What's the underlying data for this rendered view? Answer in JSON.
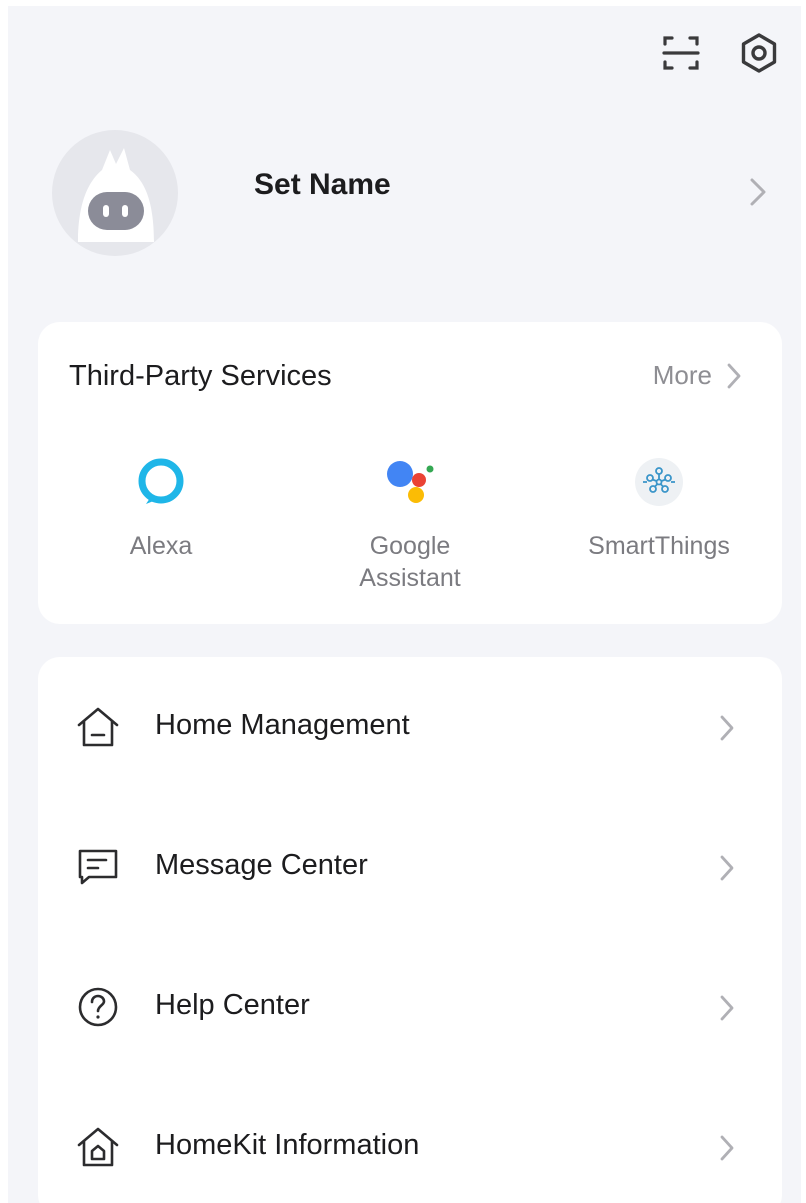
{
  "header": {
    "icons": [
      "scan-icon",
      "settings-icon"
    ]
  },
  "profile": {
    "name": "Set Name",
    "avatar_icon": "robot-avatar-icon"
  },
  "third_party": {
    "title": "Third-Party Services",
    "more_label": "More",
    "services": [
      {
        "label": "Alexa",
        "icon": "alexa-icon"
      },
      {
        "label": "Google\nAssistant",
        "icon": "google-assistant-icon"
      },
      {
        "label": "SmartThings",
        "icon": "smartthings-icon"
      }
    ]
  },
  "menu": {
    "items": [
      {
        "label": "Home Management",
        "icon": "home-icon"
      },
      {
        "label": "Message Center",
        "icon": "message-icon"
      },
      {
        "label": "Help Center",
        "icon": "help-icon"
      },
      {
        "label": "HomeKit Information",
        "icon": "homekit-icon"
      }
    ]
  },
  "colors": {
    "background": "#f4f5f9",
    "card": "#ffffff",
    "text_primary": "#1c1c1e",
    "text_secondary": "#8e8e93",
    "alexa": "#1fb6e8",
    "google_blue": "#4285f4",
    "google_red": "#ea4335",
    "google_yellow": "#fbbc05",
    "google_green": "#34a853",
    "smartthings": "#3a95c9"
  }
}
